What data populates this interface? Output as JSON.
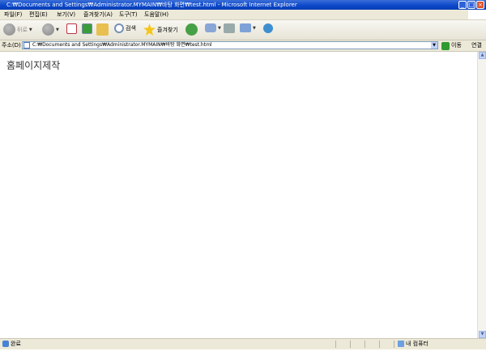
{
  "window": {
    "title": "C:₩Documents and Settings₩Administrator.MYMAIN₩바탕 화면₩test.html - Microsoft Internet Explorer"
  },
  "menu": [
    "파일(F)",
    "편집(E)",
    "보기(V)",
    "즐겨찾기(A)",
    "도구(T)",
    "도움말(H)"
  ],
  "toolbar": {
    "back_label": "뒤로",
    "search_label": "검색",
    "favorites_label": "즐겨찾기"
  },
  "address": {
    "label": "주소(D)",
    "value": "C:₩Documents and Settings₩Administrator.MYMAIN₩바탕 화면₩test.html",
    "go_label": "이동",
    "links_label": "연결"
  },
  "page": {
    "text": "홈페이지제작"
  },
  "status": {
    "text": "완료",
    "zone": "내 컴퓨터"
  }
}
